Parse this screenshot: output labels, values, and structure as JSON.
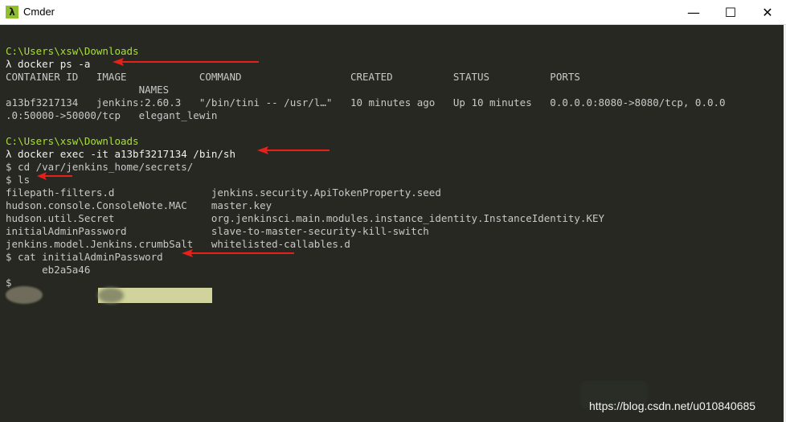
{
  "window": {
    "title": "Cmder",
    "app_icon_glyph": "λ",
    "minimize_glyph": "—",
    "maximize_glyph": "☐",
    "close_glyph": "✕"
  },
  "terminal": {
    "lines": [
      "C:\\Users\\xsw\\Downloads",
      "λ docker ps -a",
      "CONTAINER ID   IMAGE            COMMAND                  CREATED          STATUS          PORTS",
      "                      NAMES",
      "a13bf3217134   jenkins:2.60.3   \"/bin/tini -- /usr/l…\"   10 minutes ago   Up 10 minutes   0.0.0.0:8080->8080/tcp, 0.0.0",
      ".0:50000->50000/tcp   elegant_lewin",
      "",
      "C:\\Users\\xsw\\Downloads",
      "λ docker exec -it a13bf3217134 /bin/sh",
      "$ cd /var/jenkins_home/secrets/",
      "$ ls",
      "filepath-filters.d                jenkins.security.ApiTokenProperty.seed",
      "hudson.console.ConsoleNote.MAC    master.key",
      "hudson.util.Secret                org.jenkinsci.main.modules.instance_identity.InstanceIdentity.KEY",
      "initialAdminPassword              slave-to-master-security-kill-switch",
      "jenkins.model.Jenkins.crumbSalt   whitelisted-callables.d",
      "$ cat initialAdminPassword",
      "      eb2a5a46",
      "$"
    ]
  },
  "watermark": "https://blog.csdn.net/u010840685",
  "colors": {
    "background": "#272822",
    "path_green": "#a6e22e",
    "text": "#c8c8c8",
    "arrow_red": "#e8201b"
  }
}
